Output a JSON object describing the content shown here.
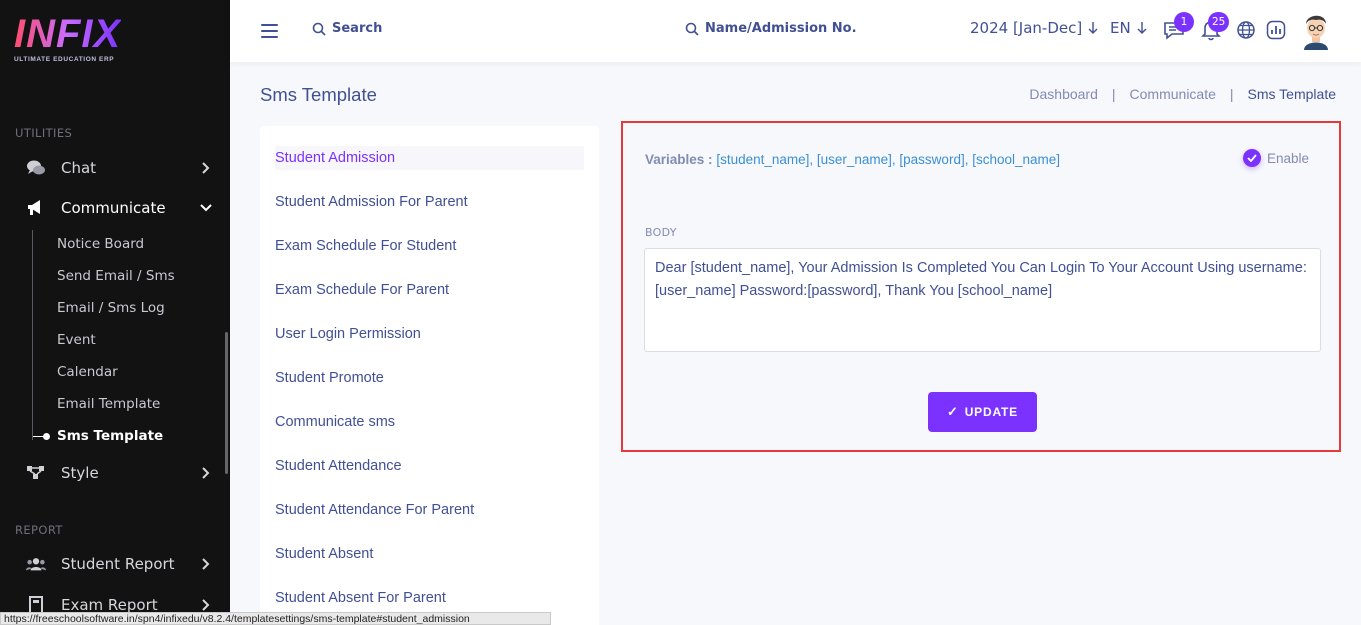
{
  "brand": {
    "name": "INFIX",
    "tagline": "ULTIMATE EDUCATION ERP"
  },
  "sidebar": {
    "utilities_title": "UTILITIES",
    "report_title": "REPORT",
    "chat": {
      "label": "Chat",
      "icon": "chat-icon"
    },
    "communicate": {
      "label": "Communicate",
      "icon": "megaphone-icon",
      "children": [
        {
          "label": "Notice Board"
        },
        {
          "label": "Send Email / Sms"
        },
        {
          "label": "Email / Sms Log"
        },
        {
          "label": "Event"
        },
        {
          "label": "Calendar"
        },
        {
          "label": "Email Template"
        },
        {
          "label": "Sms Template"
        }
      ]
    },
    "style": {
      "label": "Style",
      "icon": "style-icon"
    },
    "student_report": {
      "label": "Student Report",
      "icon": "users-icon"
    },
    "exam_report": {
      "label": "Exam Report",
      "icon": "book-icon"
    }
  },
  "topbar": {
    "search_label": "Search",
    "search_name_placeholder": "Name/Admission No.",
    "session": "2024 [Jan-Dec]",
    "language": "EN",
    "messages_count": "1",
    "notifications_count": "25"
  },
  "page": {
    "title": "Sms Template",
    "breadcrumb": [
      "Dashboard",
      "Communicate",
      "Sms Template"
    ]
  },
  "templates": [
    "Student Admission",
    "Student Admission For Parent",
    "Exam Schedule For Student",
    "Exam Schedule For Parent",
    "User Login Permission",
    "Student Promote",
    "Communicate sms",
    "Student Attendance",
    "Student Attendance For Parent",
    "Student Absent",
    "Student Absent For Parent"
  ],
  "editor": {
    "variables_label": "Variables :",
    "variables": "[student_name], [user_name], [password], [school_name]",
    "enable_label": "Enable",
    "enabled": true,
    "body_label": "BODY",
    "body": "Dear [student_name], Your Admission Is Completed You Can Login To Your Account Using username:[user_name] Password:[password], Thank You [school_name]",
    "update_label": "UPDATE"
  },
  "status_url": "https://freeschoolsoftware.in/spn4/infixedu/v8.2.4/templatesettings/sms-template#student_admission",
  "colors": {
    "accent": "#7c32ff",
    "sidebar_bg": "#121212",
    "text": "#415094",
    "highlight_border": "#e53a3a"
  }
}
